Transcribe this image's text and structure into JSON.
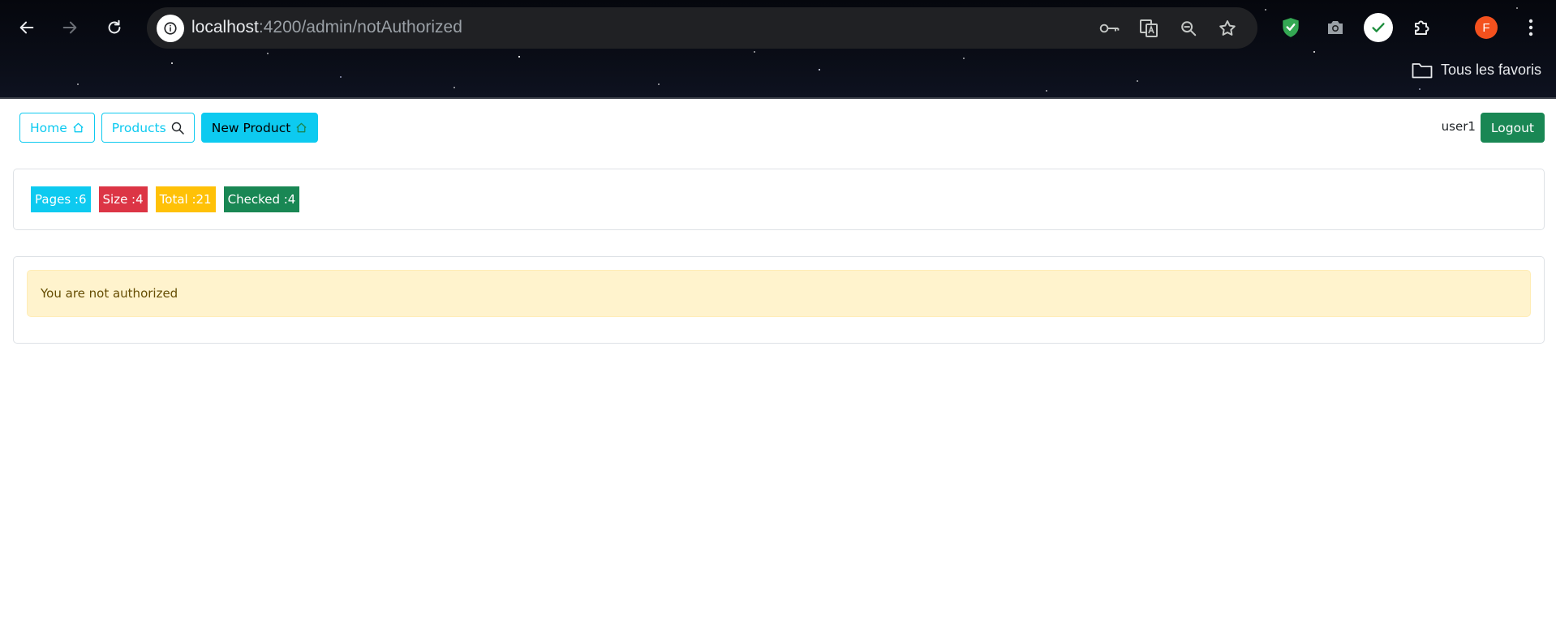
{
  "browser": {
    "url_host": "localhost",
    "url_path": ":4200/admin/notAuthorized",
    "bookmarks_label": "Tous les favoris",
    "profile_initial": "F",
    "icons": [
      "back-icon",
      "forward-icon",
      "reload-icon",
      "site-info-icon",
      "password-key-icon",
      "translate-icon",
      "zoom-out-icon",
      "bookmark-star-icon",
      "shield-extension-icon",
      "camera-extension-icon",
      "check-extension-icon",
      "extensions-puzzle-icon",
      "profile-avatar",
      "menu-dots-icon",
      "folder-icon"
    ]
  },
  "navbar": {
    "home_label": "Home",
    "products_label": "Products",
    "new_product_label": "New Product",
    "username": "user1",
    "logout_label": "Logout"
  },
  "stats": {
    "pages": "Pages :6",
    "size": "Size :4",
    "total": "Total :21",
    "checked": "Checked :4"
  },
  "alert": {
    "message": "You are not authorized"
  },
  "colors": {
    "info": "#0dcaf0",
    "danger": "#dc3545",
    "warning": "#ffc107",
    "success": "#198754",
    "alert_bg": "#fff3cd",
    "alert_text": "#664d03"
  }
}
